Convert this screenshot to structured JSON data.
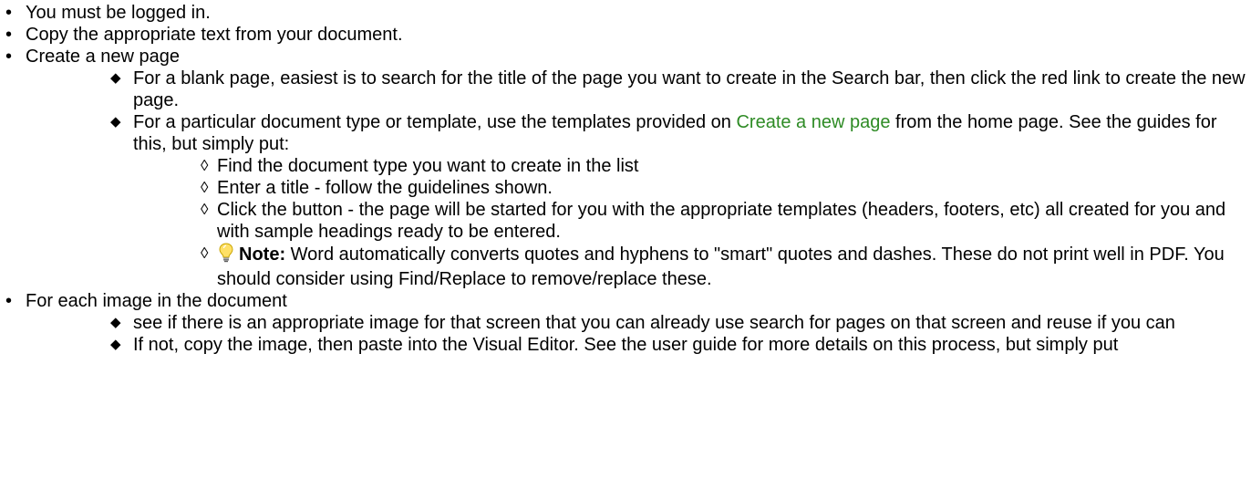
{
  "list": {
    "item1": "You must be logged in.",
    "item2": "Copy the appropriate text from your document.",
    "item3": "Create a new page",
    "item3_sub1": "For a blank page, easiest is to search for the title of the page you want to create in the Search bar, then click the red link to create the new page.",
    "item3_sub2_before": "For a particular document type or template, use the templates provided on ",
    "item3_sub2_link": "Create a new page",
    "item3_sub2_after": " from the home page. See the guides for this, but simply put:",
    "steps": [
      "Find the document type you want to create in the list",
      "Enter a title - follow the guidelines shown.",
      "Click the button - the page will be started for you with the appropriate templates (headers, footers, etc) all created for you and with sample headings ready to be entered."
    ],
    "note_label": "Note:",
    "note_text": " Word automatically converts quotes and hyphens to \"smart\" quotes and dashes. These do not print well in PDF. You should consider using Find/Replace to remove/replace these.",
    "item4": "For each image in the document",
    "item4_sub1": "see if there is an appropriate image for that screen that you can already use search for pages on that screen and reuse if you can",
    "item4_sub2": "If not, copy the image, then paste into the Visual Editor. See the user guide for more details on this process, but simply put"
  },
  "icons": {
    "note": "lightbulb-icon",
    "link_color": "#2e8b25"
  }
}
